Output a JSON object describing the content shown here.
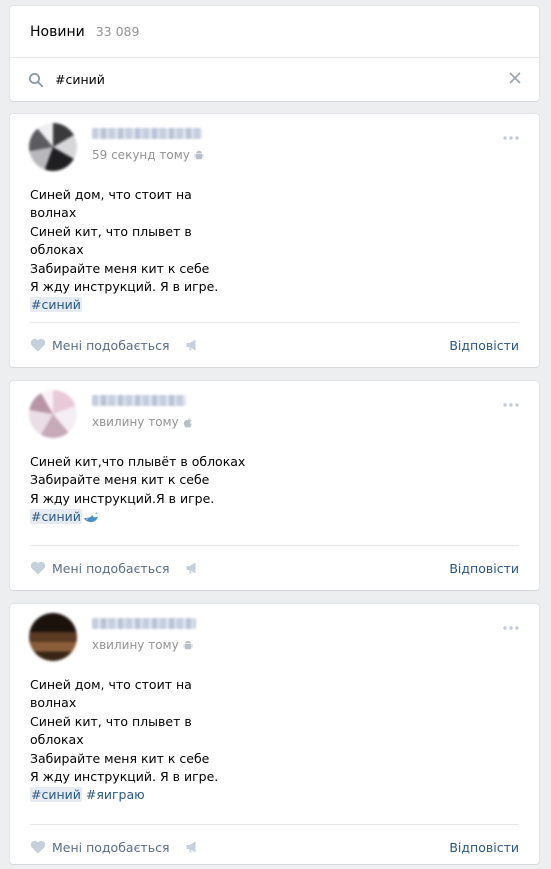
{
  "header": {
    "title": "Новини",
    "count": "33 089"
  },
  "search": {
    "value": "#синий",
    "icon": "search-icon",
    "clear_icon": "close-icon"
  },
  "colors": {
    "background": "#edeef0",
    "link": "#2a5885",
    "hashtag_bg": "#e5ebf1",
    "meta": "#939393"
  },
  "posts": [
    {
      "time": "59 секунд тому",
      "platform_icon": "android-icon",
      "lines": [
        "Синей дом, что стоит на",
        "волнах",
        "Синей кит, что плывет в",
        "облоках",
        "Забирайте меня кит к себе",
        "Я жду инструкций. Я в игре."
      ],
      "hashtags": [
        "#синий"
      ],
      "like_label": "Мені подобається",
      "reply_label": "Відповісти"
    },
    {
      "time": "хвилину тому",
      "platform_icon": "apple-icon",
      "lines": [
        "Синей кит,что плывёт в облоках",
        "Забирайте меня кит к себе",
        "Я жду инструкций.Я в игре."
      ],
      "hashtags": [
        "#синий"
      ],
      "emoji": "whale-emoji",
      "like_label": "Мені подобається",
      "reply_label": "Відповісти"
    },
    {
      "time": "хвилину тому",
      "platform_icon": "android-icon",
      "lines": [
        "Синей дом, что стоит на",
        "волнах",
        "Синей кит, что плывет в",
        "облоках",
        "Забирайте меня кит к себе",
        "Я жду инструкций. Я в игре."
      ],
      "hashtags": [
        "#синий",
        "#яиграю"
      ],
      "like_label": "Мені подобається",
      "reply_label": "Відповісти"
    }
  ]
}
